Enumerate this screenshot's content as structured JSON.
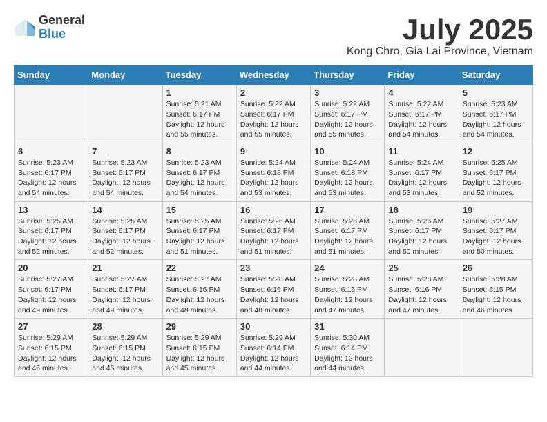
{
  "logo": {
    "general": "General",
    "blue": "Blue"
  },
  "title": "July 2025",
  "location": "Kong Chro, Gia Lai Province, Vietnam",
  "weekdays": [
    "Sunday",
    "Monday",
    "Tuesday",
    "Wednesday",
    "Thursday",
    "Friday",
    "Saturday"
  ],
  "weeks": [
    [
      {
        "day": "",
        "info": ""
      },
      {
        "day": "",
        "info": ""
      },
      {
        "day": "1",
        "info": "Sunrise: 5:21 AM\nSunset: 6:17 PM\nDaylight: 12 hours and 55 minutes."
      },
      {
        "day": "2",
        "info": "Sunrise: 5:22 AM\nSunset: 6:17 PM\nDaylight: 12 hours and 55 minutes."
      },
      {
        "day": "3",
        "info": "Sunrise: 5:22 AM\nSunset: 6:17 PM\nDaylight: 12 hours and 55 minutes."
      },
      {
        "day": "4",
        "info": "Sunrise: 5:22 AM\nSunset: 6:17 PM\nDaylight: 12 hours and 54 minutes."
      },
      {
        "day": "5",
        "info": "Sunrise: 5:23 AM\nSunset: 6:17 PM\nDaylight: 12 hours and 54 minutes."
      }
    ],
    [
      {
        "day": "6",
        "info": "Sunrise: 5:23 AM\nSunset: 6:17 PM\nDaylight: 12 hours and 54 minutes."
      },
      {
        "day": "7",
        "info": "Sunrise: 5:23 AM\nSunset: 6:17 PM\nDaylight: 12 hours and 54 minutes."
      },
      {
        "day": "8",
        "info": "Sunrise: 5:23 AM\nSunset: 6:17 PM\nDaylight: 12 hours and 54 minutes."
      },
      {
        "day": "9",
        "info": "Sunrise: 5:24 AM\nSunset: 6:18 PM\nDaylight: 12 hours and 53 minutes."
      },
      {
        "day": "10",
        "info": "Sunrise: 5:24 AM\nSunset: 6:18 PM\nDaylight: 12 hours and 53 minutes."
      },
      {
        "day": "11",
        "info": "Sunrise: 5:24 AM\nSunset: 6:17 PM\nDaylight: 12 hours and 53 minutes."
      },
      {
        "day": "12",
        "info": "Sunrise: 5:25 AM\nSunset: 6:17 PM\nDaylight: 12 hours and 52 minutes."
      }
    ],
    [
      {
        "day": "13",
        "info": "Sunrise: 5:25 AM\nSunset: 6:17 PM\nDaylight: 12 hours and 52 minutes."
      },
      {
        "day": "14",
        "info": "Sunrise: 5:25 AM\nSunset: 6:17 PM\nDaylight: 12 hours and 52 minutes."
      },
      {
        "day": "15",
        "info": "Sunrise: 5:25 AM\nSunset: 6:17 PM\nDaylight: 12 hours and 51 minutes."
      },
      {
        "day": "16",
        "info": "Sunrise: 5:26 AM\nSunset: 6:17 PM\nDaylight: 12 hours and 51 minutes."
      },
      {
        "day": "17",
        "info": "Sunrise: 5:26 AM\nSunset: 6:17 PM\nDaylight: 12 hours and 51 minutes."
      },
      {
        "day": "18",
        "info": "Sunrise: 5:26 AM\nSunset: 6:17 PM\nDaylight: 12 hours and 50 minutes."
      },
      {
        "day": "19",
        "info": "Sunrise: 5:27 AM\nSunset: 6:17 PM\nDaylight: 12 hours and 50 minutes."
      }
    ],
    [
      {
        "day": "20",
        "info": "Sunrise: 5:27 AM\nSunset: 6:17 PM\nDaylight: 12 hours and 49 minutes."
      },
      {
        "day": "21",
        "info": "Sunrise: 5:27 AM\nSunset: 6:17 PM\nDaylight: 12 hours and 49 minutes."
      },
      {
        "day": "22",
        "info": "Sunrise: 5:27 AM\nSunset: 6:16 PM\nDaylight: 12 hours and 48 minutes."
      },
      {
        "day": "23",
        "info": "Sunrise: 5:28 AM\nSunset: 6:16 PM\nDaylight: 12 hours and 48 minutes."
      },
      {
        "day": "24",
        "info": "Sunrise: 5:28 AM\nSunset: 6:16 PM\nDaylight: 12 hours and 47 minutes."
      },
      {
        "day": "25",
        "info": "Sunrise: 5:28 AM\nSunset: 6:16 PM\nDaylight: 12 hours and 47 minutes."
      },
      {
        "day": "26",
        "info": "Sunrise: 5:28 AM\nSunset: 6:15 PM\nDaylight: 12 hours and 46 minutes."
      }
    ],
    [
      {
        "day": "27",
        "info": "Sunrise: 5:29 AM\nSunset: 6:15 PM\nDaylight: 12 hours and 46 minutes."
      },
      {
        "day": "28",
        "info": "Sunrise: 5:29 AM\nSunset: 6:15 PM\nDaylight: 12 hours and 45 minutes."
      },
      {
        "day": "29",
        "info": "Sunrise: 5:29 AM\nSunset: 6:15 PM\nDaylight: 12 hours and 45 minutes."
      },
      {
        "day": "30",
        "info": "Sunrise: 5:29 AM\nSunset: 6:14 PM\nDaylight: 12 hours and 44 minutes."
      },
      {
        "day": "31",
        "info": "Sunrise: 5:30 AM\nSunset: 6:14 PM\nDaylight: 12 hours and 44 minutes."
      },
      {
        "day": "",
        "info": ""
      },
      {
        "day": "",
        "info": ""
      }
    ]
  ]
}
